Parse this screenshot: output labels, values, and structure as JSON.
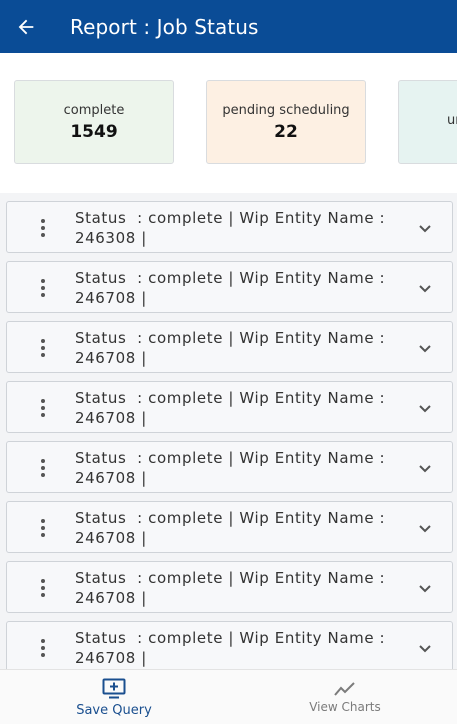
{
  "header": {
    "title": "Report : Job Status"
  },
  "cards": [
    {
      "label": "complete",
      "value": "1549"
    },
    {
      "label": "pending scheduling",
      "value": "22"
    },
    {
      "label": "un",
      "value": ""
    }
  ],
  "rows": [
    {
      "line1": "Status  : complete | Wip Entity Name :",
      "line2": "246308 |"
    },
    {
      "line1": "Status  : complete | Wip Entity Name :",
      "line2": "246708 |"
    },
    {
      "line1": "Status  : complete | Wip Entity Name :",
      "line2": "246708 |"
    },
    {
      "line1": "Status  : complete | Wip Entity Name :",
      "line2": "246708 |"
    },
    {
      "line1": "Status  : complete | Wip Entity Name :",
      "line2": "246708 |"
    },
    {
      "line1": "Status  : complete | Wip Entity Name :",
      "line2": "246708 |"
    },
    {
      "line1": "Status  : complete | Wip Entity Name :",
      "line2": "246708 |"
    },
    {
      "line1": "Status  : complete | Wip Entity Name :",
      "line2": "246708 |"
    }
  ],
  "bottom_nav": {
    "save_label": "Save Query",
    "charts_label": "View Charts"
  },
  "colors": {
    "header_bg": "#0a4c96",
    "card_complete_bg": "#edf5ec",
    "card_pending_bg": "#fdf0e3",
    "card_third_bg": "#e6f3f1",
    "nav_active": "#1a4f8f"
  },
  "icons": {
    "back": "arrow-left-icon",
    "row_menu": "more-vertical-icon",
    "row_expand": "chevron-down-icon",
    "save": "add-to-queue-icon",
    "charts": "line-chart-icon"
  }
}
